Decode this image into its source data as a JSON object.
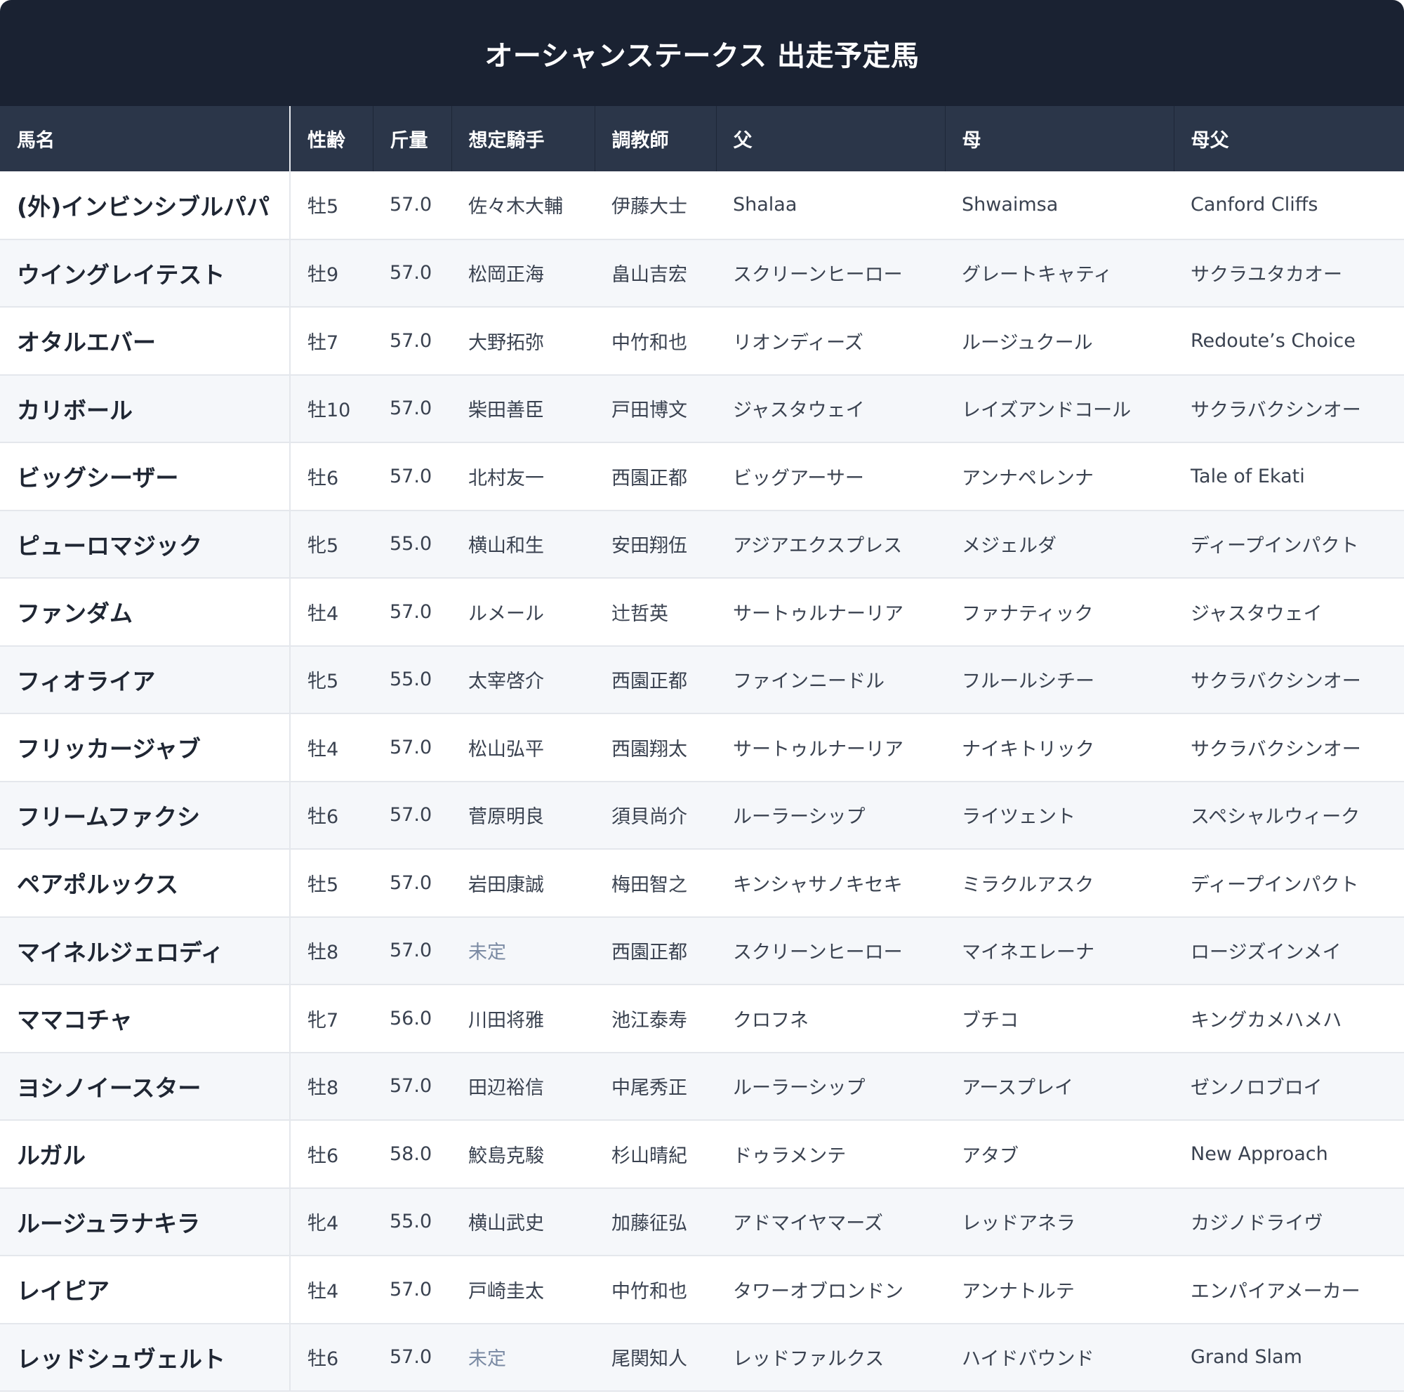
{
  "title": "オーシャンステークス 出走予定馬",
  "columns": [
    "馬名",
    "性齢",
    "斤量",
    "想定騎手",
    "調教師",
    "父",
    "母",
    "母父"
  ],
  "colors": {
    "title_bg": "#1a2232",
    "header_bg": "#2b3649",
    "row_alt_bg": "#f5f7fa",
    "tbd_text": "#7a8aa3"
  },
  "rows": [
    {
      "name": "(外)インビンシブルパパ",
      "sex_age": "牡5",
      "weight": "57.0",
      "jockey": "佐々木大輔",
      "trainer": "伊藤大士",
      "sire": "Shalaa",
      "dam": "Shwaimsa",
      "damsire": "Canford Cliffs"
    },
    {
      "name": "ウイングレイテスト",
      "sex_age": "牡9",
      "weight": "57.0",
      "jockey": "松岡正海",
      "trainer": "畠山吉宏",
      "sire": "スクリーンヒーロー",
      "dam": "グレートキャティ",
      "damsire": "サクラユタカオー"
    },
    {
      "name": "オタルエバー",
      "sex_age": "牡7",
      "weight": "57.0",
      "jockey": "大野拓弥",
      "trainer": "中竹和也",
      "sire": "リオンディーズ",
      "dam": "ルージュクール",
      "damsire": "Redoute’s Choice"
    },
    {
      "name": "カリボール",
      "sex_age": "牡10",
      "weight": "57.0",
      "jockey": "柴田善臣",
      "trainer": "戸田博文",
      "sire": "ジャスタウェイ",
      "dam": "レイズアンドコール",
      "damsire": "サクラバクシンオー"
    },
    {
      "name": "ビッグシーザー",
      "sex_age": "牡6",
      "weight": "57.0",
      "jockey": "北村友一",
      "trainer": "西園正都",
      "sire": "ビッグアーサー",
      "dam": "アンナペレンナ",
      "damsire": "Tale of Ekati"
    },
    {
      "name": "ピューロマジック",
      "sex_age": "牝5",
      "weight": "55.0",
      "jockey": "横山和生",
      "trainer": "安田翔伍",
      "sire": "アジアエクスプレス",
      "dam": "メジェルダ",
      "damsire": "ディープインパクト"
    },
    {
      "name": "ファンダム",
      "sex_age": "牡4",
      "weight": "57.0",
      "jockey": "ルメール",
      "trainer": "辻哲英",
      "sire": "サートゥルナーリア",
      "dam": "ファナティック",
      "damsire": "ジャスタウェイ"
    },
    {
      "name": "フィオライア",
      "sex_age": "牝5",
      "weight": "55.0",
      "jockey": "太宰啓介",
      "trainer": "西園正都",
      "sire": "ファインニードル",
      "dam": "フルールシチー",
      "damsire": "サクラバクシンオー"
    },
    {
      "name": "フリッカージャブ",
      "sex_age": "牡4",
      "weight": "57.0",
      "jockey": "松山弘平",
      "trainer": "西園翔太",
      "sire": "サートゥルナーリア",
      "dam": "ナイキトリック",
      "damsire": "サクラバクシンオー"
    },
    {
      "name": "フリームファクシ",
      "sex_age": "牡6",
      "weight": "57.0",
      "jockey": "菅原明良",
      "trainer": "須貝尚介",
      "sire": "ルーラーシップ",
      "dam": "ライツェント",
      "damsire": "スペシャルウィーク"
    },
    {
      "name": "ペアポルックス",
      "sex_age": "牡5",
      "weight": "57.0",
      "jockey": "岩田康誠",
      "trainer": "梅田智之",
      "sire": "キンシャサノキセキ",
      "dam": "ミラクルアスク",
      "damsire": "ディープインパクト"
    },
    {
      "name": "マイネルジェロディ",
      "sex_age": "牡8",
      "weight": "57.0",
      "jockey": "未定",
      "trainer": "西園正都",
      "sire": "スクリーンヒーロー",
      "dam": "マイネエレーナ",
      "damsire": "ロージズインメイ",
      "tbd": true
    },
    {
      "name": "ママコチャ",
      "sex_age": "牝7",
      "weight": "56.0",
      "jockey": "川田将雅",
      "trainer": "池江泰寿",
      "sire": "クロフネ",
      "dam": "ブチコ",
      "damsire": "キングカメハメハ"
    },
    {
      "name": "ヨシノイースター",
      "sex_age": "牡8",
      "weight": "57.0",
      "jockey": "田辺裕信",
      "trainer": "中尾秀正",
      "sire": "ルーラーシップ",
      "dam": "アースプレイ",
      "damsire": "ゼンノロブロイ"
    },
    {
      "name": "ルガル",
      "sex_age": "牡6",
      "weight": "58.0",
      "jockey": "鮫島克駿",
      "trainer": "杉山晴紀",
      "sire": "ドゥラメンテ",
      "dam": "アタブ",
      "damsire": "New Approach"
    },
    {
      "name": "ルージュラナキラ",
      "sex_age": "牝4",
      "weight": "55.0",
      "jockey": "横山武史",
      "trainer": "加藤征弘",
      "sire": "アドマイヤマーズ",
      "dam": "レッドアネラ",
      "damsire": "カジノドライヴ"
    },
    {
      "name": "レイピア",
      "sex_age": "牡4",
      "weight": "57.0",
      "jockey": "戸崎圭太",
      "trainer": "中竹和也",
      "sire": "タワーオブロンドン",
      "dam": "アンナトルテ",
      "damsire": "エンパイアメーカー"
    },
    {
      "name": "レッドシュヴェルト",
      "sex_age": "牡6",
      "weight": "57.0",
      "jockey": "未定",
      "trainer": "尾関知人",
      "sire": "レッドファルクス",
      "dam": "ハイドバウンド",
      "damsire": "Grand Slam",
      "tbd": true
    }
  ]
}
